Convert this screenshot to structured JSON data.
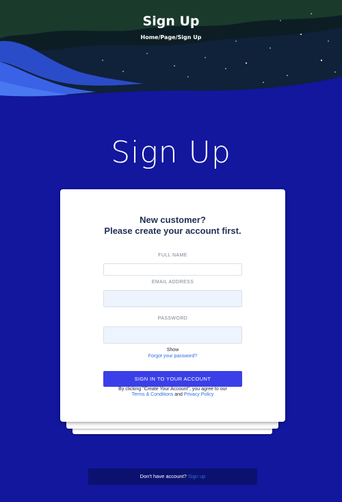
{
  "header": {
    "title": "Sign Up",
    "breadcrumb": "Home/Page/Sign Up"
  },
  "page_title": "Sign Up",
  "form": {
    "heading_line1": "New customer?",
    "heading_line2": "Please create your account first.",
    "full_name": {
      "label": "FULL NAME",
      "value": ""
    },
    "email": {
      "label": "EMAIL ADDRESS",
      "value": ""
    },
    "password": {
      "label": "PASSWORD",
      "value": ""
    },
    "show_label": "Show",
    "forgot_password": "Forgot your password?",
    "submit_label": "SIGN IN TO YOUR ACCOUNT",
    "terms_prefix": "By clicking \"Create Your Account\", you agree to our",
    "terms_link": "Terms & Conditions",
    "terms_and": "and",
    "privacy_link": "Privacy Policy"
  },
  "footer": {
    "prompt": "Don't have account?",
    "signup_link": "Sign up"
  },
  "colors": {
    "page_background": "#12179e",
    "primary_button": "#3b3fe8",
    "link": "#2e6ee0",
    "bottom_bar": "#0c1170"
  }
}
